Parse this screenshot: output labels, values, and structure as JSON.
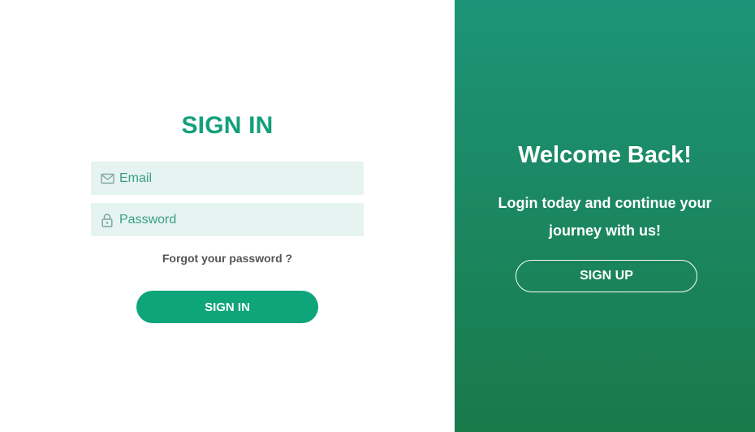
{
  "signin": {
    "title": "SIGN IN",
    "email_placeholder": "Email",
    "email_icon": "envelope-icon",
    "password_placeholder": "Password",
    "password_icon": "lock-icon",
    "forgot_label": "Forgot your password ?",
    "button_label": "SIGN IN"
  },
  "welcome_panel": {
    "title": "Welcome Back!",
    "subtitle": "Login today and continue your journey with us!",
    "button_label": "SIGN UP"
  },
  "colors": {
    "accent": "#0fa57b",
    "input_background": "#e6f4f1",
    "panel_gradient_top": "#1d9478",
    "panel_gradient_bottom": "#197a4a"
  }
}
